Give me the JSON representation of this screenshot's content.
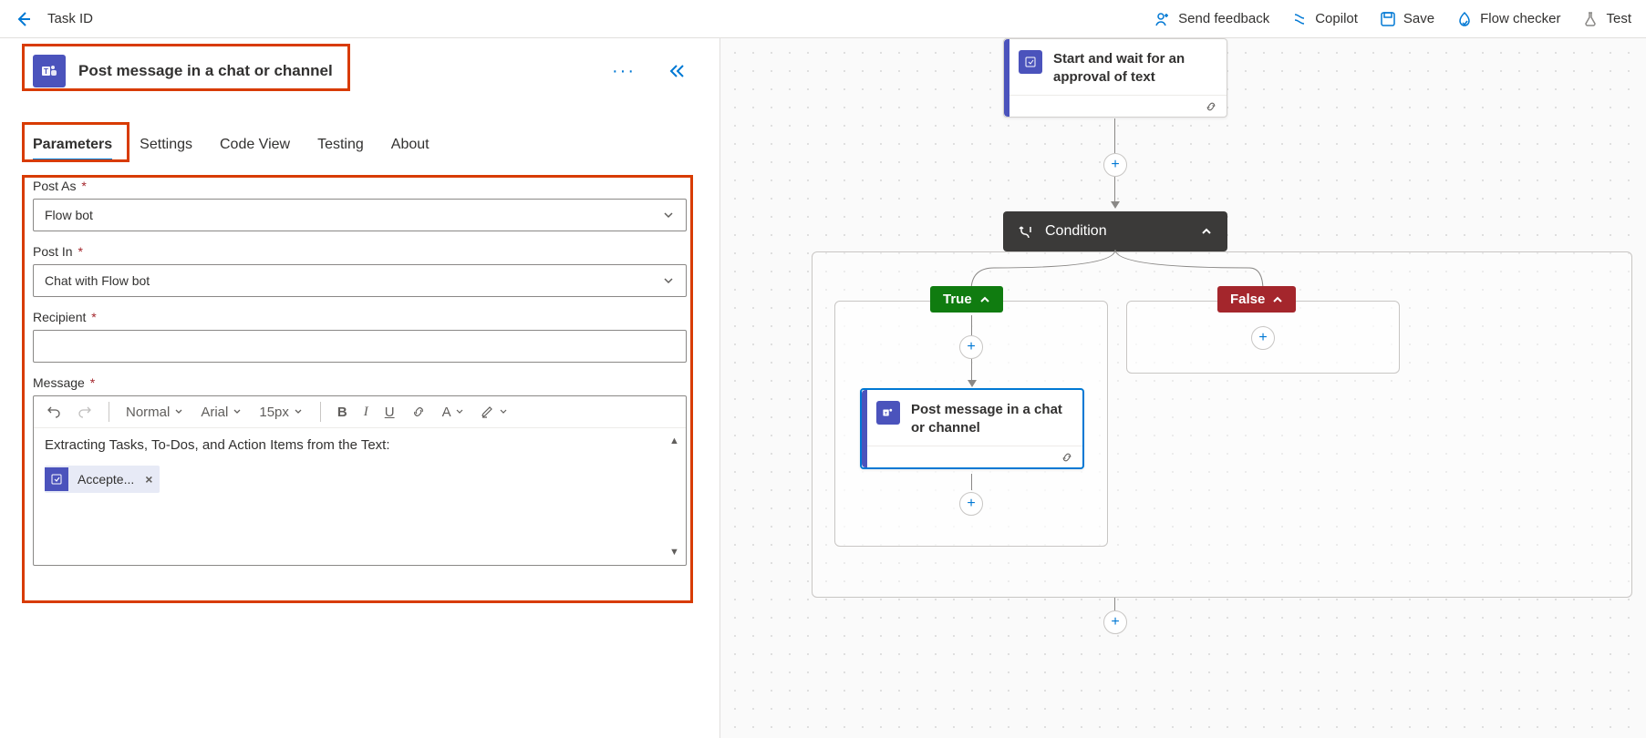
{
  "topbar": {
    "breadcrumb": "Task ID",
    "actions": {
      "feedback": "Send feedback",
      "copilot": "Copilot",
      "save": "Save",
      "flow_checker": "Flow checker",
      "test": "Test"
    }
  },
  "panel": {
    "action_title": "Post message in a chat or channel",
    "tabs": [
      "Parameters",
      "Settings",
      "Code View",
      "Testing",
      "About"
    ],
    "active_tab": "Parameters",
    "fields": {
      "post_as": {
        "label": "Post As",
        "value": "Flow bot",
        "required": true
      },
      "post_in": {
        "label": "Post In",
        "value": "Chat with Flow bot",
        "required": true
      },
      "recipient": {
        "label": "Recipient",
        "value": "",
        "required": true
      },
      "message": {
        "label": "Message",
        "required": true
      }
    },
    "editor": {
      "style": "Normal",
      "font": "Arial",
      "size": "15px",
      "body_text": "Extracting Tasks, To-Dos, and Action Items from the Text:",
      "token": "Accepte..."
    }
  },
  "canvas": {
    "approval_card": "Start and wait for an approval of text",
    "condition_label": "Condition",
    "true_label": "True",
    "false_label": "False",
    "post_card": "Post message in a chat or channel"
  }
}
